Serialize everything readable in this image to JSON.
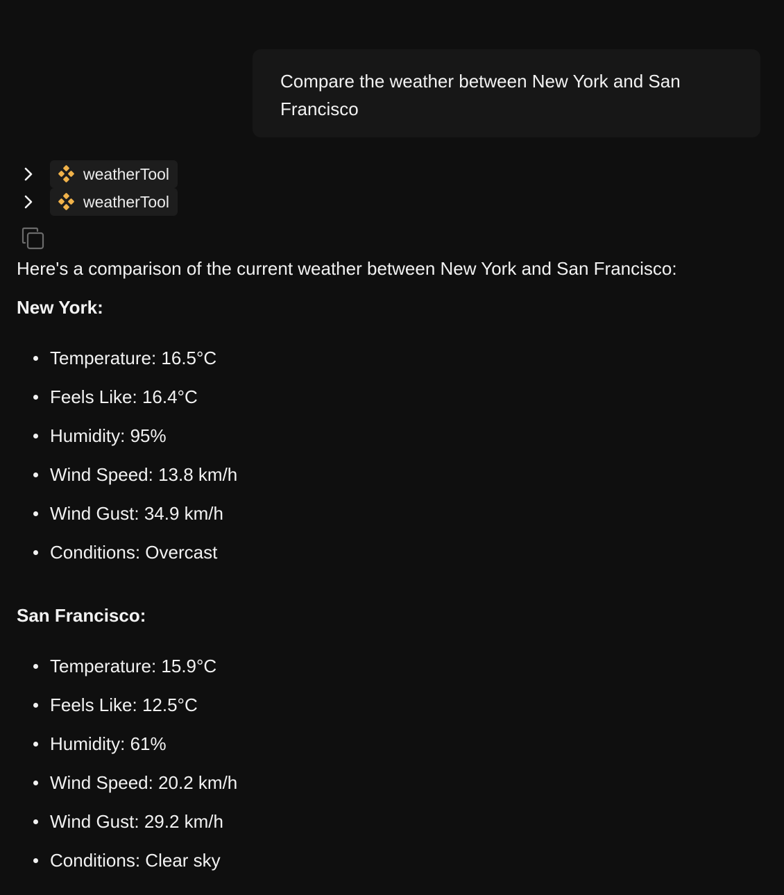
{
  "user_message": {
    "line1": "Compare the weather between New York and San",
    "line2": "Francisco"
  },
  "tool_calls": [
    {
      "name": "weatherTool",
      "icon": "tool-diamond-icon"
    },
    {
      "name": "weatherTool",
      "icon": "tool-diamond-icon"
    }
  ],
  "accent_color": "#f0b24a",
  "response": {
    "intro": "Here's a comparison of the current weather between New York and San Francisco:",
    "sections": [
      {
        "heading": "New York:",
        "items": [
          "Temperature: 16.5°C",
          "Feels Like: 16.4°C",
          "Humidity: 95%",
          "Wind Speed: 13.8 km/h",
          "Wind Gust: 34.9 km/h",
          "Conditions: Overcast"
        ]
      },
      {
        "heading": "San Francisco:",
        "items": [
          "Temperature: 15.9°C",
          "Feels Like: 12.5°C",
          "Humidity: 61%",
          "Wind Speed: 20.2 km/h",
          "Wind Gust: 29.2 km/h",
          "Conditions: Clear sky"
        ]
      }
    ]
  }
}
